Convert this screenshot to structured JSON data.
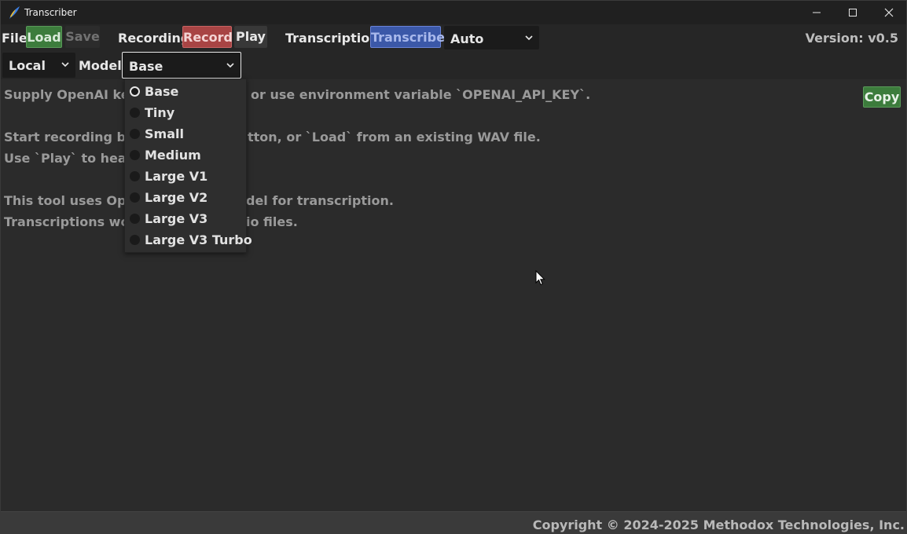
{
  "window": {
    "title": "Transcriber"
  },
  "toolbar": {
    "file_label": "File",
    "load_label": "Load",
    "save_label": "Save",
    "recording_label": "Recording",
    "record_label": "Record",
    "play_label": "Play",
    "transcription_label": "Transcription",
    "transcribe_label": "Transcribe",
    "language_value": "Auto",
    "version": "Version: v0.5"
  },
  "toolbar2": {
    "backend_value": "Local",
    "model_label": "Model:",
    "model_value": "Base"
  },
  "content": {
    "lines": [
      "Supply OpenAI key f",
      "or use environment variable `OPENAI_API_KEY`.",
      "Start recording by p",
      "tton, or `Load` from an existing WAV file.",
      "Use `Play` to hear t",
      "This tool uses Open",
      "del for transcription.",
      "Transcriptions work",
      "io files."
    ],
    "copy_label": "Copy"
  },
  "model_dropdown": {
    "selected": "Base",
    "options": [
      "Base",
      "Tiny",
      "Small",
      "Medium",
      "Large V1",
      "Large V2",
      "Large V3",
      "Large V3 Turbo"
    ]
  },
  "status": {
    "copyright": "Copyright © 2024-2025 Methodox Technologies, Inc."
  },
  "colors": {
    "load": "#3c7c3c",
    "record": "#a84444",
    "transcribe": "#3b58a8",
    "copy": "#3c7c3c"
  }
}
